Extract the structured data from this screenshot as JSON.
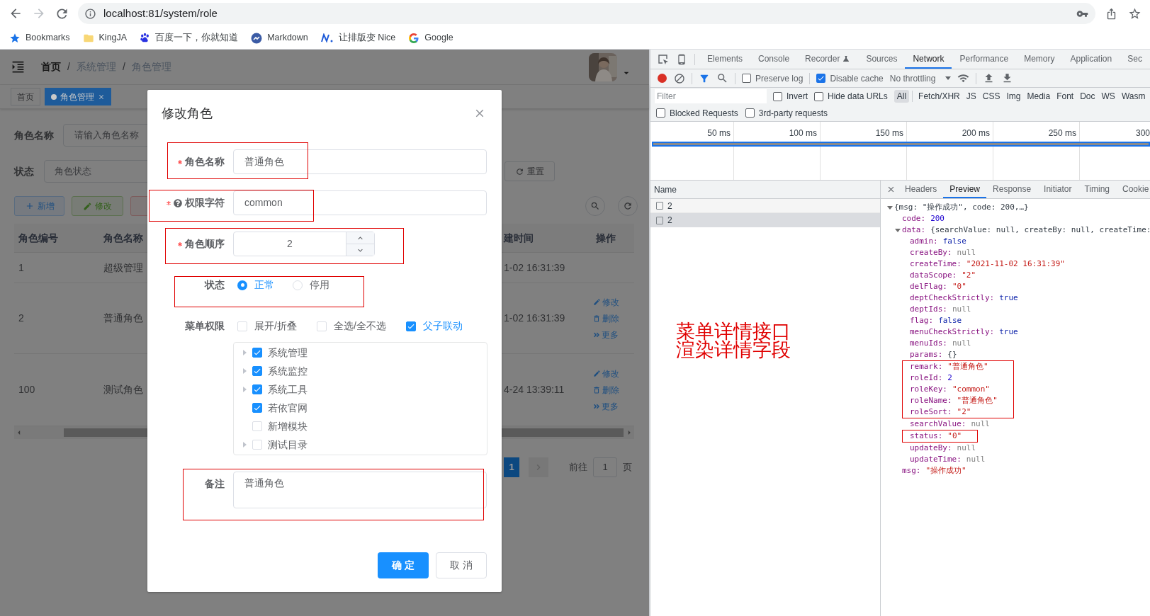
{
  "browser": {
    "url": "localhost:81/system/role",
    "bookmarks": [
      {
        "label": "Bookmarks",
        "kind": "star"
      },
      {
        "label": "KingJA",
        "kind": "folder"
      },
      {
        "label": "百度一下，你就知道",
        "kind": "paw"
      },
      {
        "label": "Markdown",
        "kind": "markdown"
      },
      {
        "label": "让排版变 Nice",
        "kind": "nice"
      },
      {
        "label": "Google",
        "kind": "google"
      }
    ]
  },
  "app": {
    "breadcrumb": [
      {
        "label": "首页",
        "kind": "home"
      },
      {
        "label": "/",
        "kind": "separator"
      },
      {
        "label": "系统管理",
        "kind": "link"
      },
      {
        "label": "/",
        "kind": "separator"
      },
      {
        "label": "角色管理",
        "kind": "link"
      }
    ],
    "tags": [
      {
        "label": "首页",
        "selected": false
      },
      {
        "label": "角色管理",
        "selected": true
      }
    ],
    "search": [
      {
        "label": "角色名称",
        "placeholder": "请输入角色名称"
      },
      {
        "label": "状态",
        "placeholder": "角色状态"
      }
    ],
    "reset_button": "重置",
    "toolbar_buttons": [
      {
        "label": "新增",
        "kind": "primary"
      },
      {
        "label": "修改",
        "kind": "success"
      },
      {
        "kind": "danger"
      }
    ],
    "table": {
      "columns": [
        "角色编号",
        "角色名称",
        "建时间",
        "操作"
      ],
      "rows": [
        {
          "cells": [
            "1",
            "超级管理",
            "1-02 16:31:39"
          ],
          "actions": []
        },
        {
          "cells": [
            "2",
            "普通角色",
            "1-02 16:31:39"
          ],
          "actions": [
            {
              "label": "修改",
              "kind": "edit"
            },
            {
              "label": "删除",
              "kind": "delete"
            },
            {
              "label": "更多",
              "kind": "more"
            }
          ]
        },
        {
          "cells": [
            "100",
            "测试角色",
            "4-24 13:39:11"
          ],
          "actions": [
            {
              "label": "修改",
              "kind": "edit"
            },
            {
              "label": "删除",
              "kind": "delete"
            },
            {
              "label": "更多",
              "kind": "more"
            }
          ]
        }
      ]
    },
    "pagination": {
      "current_page": "1",
      "goto_label": "前往",
      "page_value": "1",
      "page_unit": "页"
    }
  },
  "dialog": {
    "title": "修改角色",
    "fields": [
      {
        "kind": "text",
        "label": "角色名称",
        "required": true,
        "help": false,
        "value": "普通角色",
        "boxed": true
      },
      {
        "kind": "text",
        "label": "权限字符",
        "required": true,
        "help": true,
        "value": "common",
        "boxed": true
      },
      {
        "kind": "number",
        "label": "角色顺序",
        "required": true,
        "help": false,
        "value": "2",
        "boxed": true
      },
      {
        "kind": "radio",
        "label": "状态",
        "required": false,
        "help": false,
        "boxed": true,
        "options": [
          {
            "label": "正常",
            "selected": true
          },
          {
            "label": "停用",
            "selected": false
          }
        ]
      },
      {
        "kind": "tree",
        "label": "菜单权限",
        "required": false,
        "help": false,
        "boxed": false,
        "options": [
          {
            "label": "展开/折叠",
            "checked": false
          },
          {
            "label": "全选/全不选",
            "checked": false
          },
          {
            "label": "父子联动",
            "checked": true
          }
        ],
        "items": [
          {
            "label": "系统管理",
            "checked": true,
            "has_children": true
          },
          {
            "label": "系统监控",
            "checked": true,
            "has_children": true
          },
          {
            "label": "系统工具",
            "checked": true,
            "has_children": true
          },
          {
            "label": "若依官网",
            "checked": true,
            "has_children": false
          },
          {
            "label": "新增模块",
            "checked": false,
            "has_children": false
          },
          {
            "label": "测试目录",
            "checked": false,
            "has_children": true
          }
        ]
      },
      {
        "kind": "textarea",
        "label": "备注",
        "required": false,
        "help": false,
        "value": "普通角色",
        "boxed": true
      }
    ],
    "buttons": [
      {
        "label": "确 定",
        "kind": "primary"
      },
      {
        "label": "取 消",
        "kind": "default"
      }
    ]
  },
  "devtools": {
    "tabs": [
      {
        "label": "Elements",
        "selected": false,
        "experimental": false
      },
      {
        "label": "Console",
        "selected": false,
        "experimental": false
      },
      {
        "label": "Recorder",
        "selected": false,
        "experimental": true
      },
      {
        "label": "Sources",
        "selected": false,
        "experimental": false
      },
      {
        "label": "Network",
        "selected": true,
        "experimental": false
      },
      {
        "label": "Performance",
        "selected": false,
        "experimental": false
      },
      {
        "label": "Memory",
        "selected": false,
        "experimental": false
      },
      {
        "label": "Application",
        "selected": false,
        "experimental": false
      },
      {
        "label": "Sec",
        "selected": false,
        "experimental": false
      }
    ],
    "toolbar": {
      "recording": true,
      "preserve_log": {
        "label": "Preserve log",
        "checked": false
      },
      "disable_cache": {
        "label": "Disable cache",
        "checked": true
      },
      "throttling": "No throttling"
    },
    "filter": {
      "placeholder": "Filter",
      "options": [
        {
          "label": "Invert",
          "checked": false
        },
        {
          "label": "Hide data URLs",
          "checked": false
        }
      ],
      "types": [
        {
          "label": "All",
          "selected": true
        },
        {
          "label": "Fetch/XHR",
          "selected": false
        },
        {
          "label": "JS",
          "selected": false
        },
        {
          "label": "CSS",
          "selected": false
        },
        {
          "label": "Img",
          "selected": false
        },
        {
          "label": "Media",
          "selected": false
        },
        {
          "label": "Font",
          "selected": false
        },
        {
          "label": "Doc",
          "selected": false
        },
        {
          "label": "WS",
          "selected": false
        },
        {
          "label": "Wasm",
          "selected": false
        }
      ]
    },
    "blocked": [
      {
        "label": "Blocked Requests",
        "checked": false
      },
      {
        "label": "3rd-party requests",
        "checked": false
      }
    ],
    "timeline_ticks": [
      "50 ms",
      "100 ms",
      "150 ms",
      "200 ms",
      "250 ms",
      "300"
    ],
    "requests": {
      "column": "Name",
      "rows": [
        {
          "name": "2",
          "selected": false
        },
        {
          "name": "2",
          "selected": true
        }
      ]
    },
    "detail_tabs": [
      {
        "label": "Headers",
        "selected": false
      },
      {
        "label": "Preview",
        "selected": true
      },
      {
        "label": "Response",
        "selected": false
      },
      {
        "label": "Initiator",
        "selected": false
      },
      {
        "label": "Timing",
        "selected": false
      },
      {
        "label": "Cookie",
        "selected": false
      }
    ],
    "preview": {
      "summary": "{msg: \"操作成功\", code: 200,…}",
      "expanded": true,
      "children": [
        {
          "key": "code:",
          "value": "200",
          "kind": "number"
        },
        {
          "key": "data:",
          "summary": "{searchValue: null, createBy: null, createTime:",
          "expanded": true,
          "children": [
            {
              "key": "admin:",
              "value": "false",
              "kind": "boolean",
              "boxed": false
            },
            {
              "key": "createBy:",
              "value": "null",
              "kind": "null",
              "boxed": false
            },
            {
              "key": "createTime:",
              "value": "\"2021-11-02 16:31:39\"",
              "kind": "string",
              "boxed": false
            },
            {
              "key": "dataScope:",
              "value": "\"2\"",
              "kind": "string",
              "boxed": false
            },
            {
              "key": "delFlag:",
              "value": "\"0\"",
              "kind": "string",
              "boxed": false
            },
            {
              "key": "deptCheckStrictly:",
              "value": "true",
              "kind": "boolean",
              "boxed": false
            },
            {
              "key": "deptIds:",
              "value": "null",
              "kind": "null",
              "boxed": false
            },
            {
              "key": "flag:",
              "value": "false",
              "kind": "boolean",
              "boxed": false
            },
            {
              "key": "menuCheckStrictly:",
              "value": "true",
              "kind": "boolean",
              "boxed": false
            },
            {
              "key": "menuIds:",
              "value": "null",
              "kind": "null",
              "boxed": false
            },
            {
              "key": "params:",
              "value": "{}",
              "kind": "object",
              "boxed": false
            },
            {
              "key": "remark:",
              "value": "\"普通角色\"",
              "kind": "string",
              "boxed": true
            },
            {
              "key": "roleId:",
              "value": "2",
              "kind": "number",
              "boxed": true
            },
            {
              "key": "roleKey:",
              "value": "\"common\"",
              "kind": "string",
              "boxed": true
            },
            {
              "key": "roleName:",
              "value": "\"普通角色\"",
              "kind": "string",
              "boxed": true
            },
            {
              "key": "roleSort:",
              "value": "\"2\"",
              "kind": "string",
              "boxed": true
            },
            {
              "key": "searchValue:",
              "value": "null",
              "kind": "null",
              "boxed": false
            },
            {
              "key": "status:",
              "value": "\"0\"",
              "kind": "string",
              "boxed": true
            },
            {
              "key": "updateBy:",
              "value": "null",
              "kind": "null",
              "boxed": false
            },
            {
              "key": "updateTime:",
              "value": "null",
              "kind": "null",
              "boxed": false
            }
          ]
        },
        {
          "key": "msg:",
          "value": "\"操作成功\"",
          "kind": "string"
        }
      ]
    }
  },
  "annotation": {
    "lines": [
      "菜单详情接口",
      "渲染详情字段"
    ]
  }
}
